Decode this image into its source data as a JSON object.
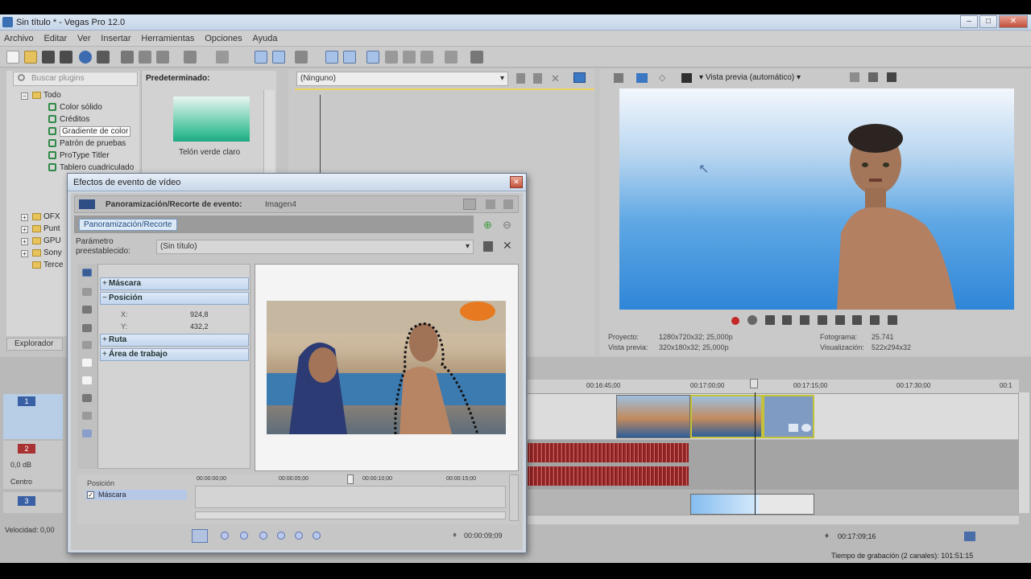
{
  "window": {
    "title": "Sin título * - Vegas Pro 12.0"
  },
  "menu": [
    "Archivo",
    "Editar",
    "Ver",
    "Insertar",
    "Herramientas",
    "Opciones",
    "Ayuda"
  ],
  "explorer": {
    "search_placeholder": "Buscar plugins",
    "tab_label": "Explorador",
    "tree": [
      "Todo",
      "Color sólido",
      "Créditos",
      "Gradiente de color",
      "Patrón de pruebas",
      "ProType Titler",
      "Tablero cuadriculado",
      "OFX",
      "Punt",
      "GPU",
      "Sony",
      "Terce"
    ]
  },
  "presets": {
    "header": "Predeterminado:",
    "item_label": "Telón verde claro"
  },
  "trimmer": {
    "combo_value": "(Ninguno)"
  },
  "preview": {
    "mode_label": "Vista previa (automático)",
    "project_label": "Proyecto:",
    "project_value": "1280x720x32; 25,000p",
    "preview_label": "Vista previa:",
    "preview_value": "320x180x32; 25,000p",
    "frame_label": "Fotograma:",
    "frame_value": "25.741",
    "display_label": "Visualización:",
    "display_value": "522x294x32"
  },
  "timeline": {
    "ruler_ticks": [
      "00:16:45;00",
      "00:17:00;00",
      "00:17:15;00",
      "00:17:30;00",
      "00:1"
    ],
    "track1_num": "1",
    "track2_num": "2",
    "track3_num": "3",
    "volume_db": "0,0 dB",
    "center_label": "Centro",
    "rate_label": "Velocidad: 0,00",
    "time_code": "00:17:09;16",
    "record_time": "Tiempo de grabación (2 canales): 101:51:15"
  },
  "dialog": {
    "title": "Efectos de evento de vídeo",
    "fx_header": "Panoramización/Recorte de evento:",
    "fx_header_target": "Imagen4",
    "chain_tag": "Panoramización/Recorte",
    "preset_label": "Parámetro preestablecido:",
    "preset_value": "(Sin título)",
    "params": {
      "mascara": "Máscara",
      "posicion": "Posición",
      "x_label": "X:",
      "x_value": "924,8",
      "y_label": "Y:",
      "y_value": "432,2",
      "ruta": "Ruta",
      "area": "Área de trabajo"
    },
    "kf_ruler": [
      "00:00:00;00",
      "00:00:05;00",
      "00:00:10;00",
      "00:00:15;00"
    ],
    "kf_tracks": [
      "Posición",
      "Máscara"
    ],
    "duration": "00:00:09;09"
  }
}
